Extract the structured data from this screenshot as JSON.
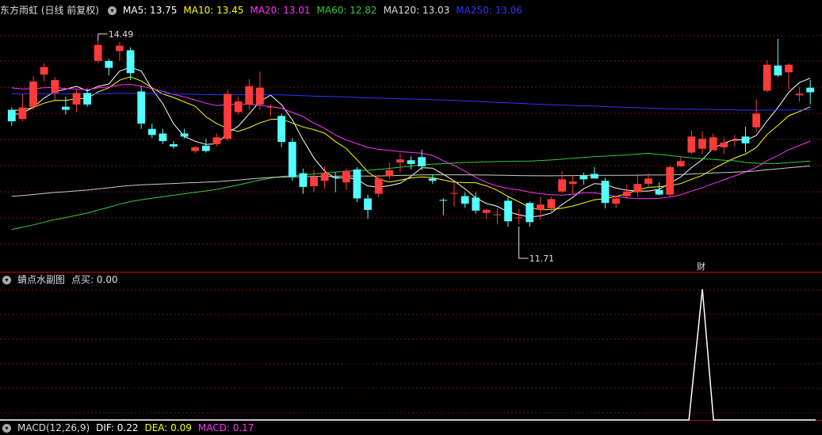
{
  "colors": {
    "up": "#ff3b3b",
    "down": "#54ffff",
    "ma5": "#ffffff",
    "ma10": "#ffff00",
    "ma20": "#ff33ff",
    "ma60": "#33cc33",
    "ma120": "#cccccc",
    "ma250": "#3333ff",
    "grid": "#7a1010",
    "divider": "#b01010",
    "indicator": "#ffffff"
  },
  "main_header": {
    "title": "东方雨虹 (日线 前复权)",
    "ma5": "MA5: 13.75",
    "ma10": "MA10: 13.45",
    "ma20": "MA20: 13.01",
    "ma60": "MA60: 12.82",
    "ma120": "MA120: 13.03",
    "ma250": "MA250: 13.06"
  },
  "price_labels": {
    "high": "14.49",
    "low": "11.71",
    "cai": "财"
  },
  "sub_header": {
    "title": "蜻点水副图",
    "value": "点买: 0.00"
  },
  "bottom_header": {
    "title": "MACD(12,26,9)",
    "dif": "DIF: 0.22",
    "dea": "DEA: 0.09",
    "macd": "MACD: 0.17"
  },
  "chart_data": {
    "type": "candlestick",
    "y_range": [
      11.5,
      14.8
    ],
    "candles": [
      [
        13.59,
        13.44,
        13.38,
        13.62
      ],
      [
        13.47,
        13.62,
        13.44,
        13.8
      ],
      [
        13.63,
        13.96,
        13.59,
        14.03
      ],
      [
        14.05,
        14.15,
        13.96,
        14.2
      ],
      [
        13.81,
        13.98,
        13.72,
        14.02
      ],
      [
        13.63,
        13.59,
        13.53,
        13.76
      ],
      [
        13.66,
        13.81,
        13.56,
        13.85
      ],
      [
        13.81,
        13.66,
        13.63,
        13.87
      ],
      [
        14.23,
        14.44,
        14.2,
        14.49
      ],
      [
        14.23,
        14.14,
        14.04,
        14.26
      ],
      [
        14.36,
        14.43,
        14.23,
        14.48
      ],
      [
        14.37,
        14.07,
        13.98,
        14.41
      ],
      [
        13.83,
        13.41,
        13.34,
        13.9
      ],
      [
        13.34,
        13.26,
        13.22,
        13.41
      ],
      [
        13.28,
        13.18,
        13.14,
        13.34
      ],
      [
        13.14,
        13.11,
        13.08,
        13.18
      ],
      [
        13.28,
        13.24,
        13.21,
        13.34
      ],
      [
        13.05,
        13.1,
        13.02,
        13.12
      ],
      [
        13.12,
        13.05,
        13.03,
        13.21
      ],
      [
        13.14,
        13.23,
        13.11,
        13.28
      ],
      [
        13.21,
        13.8,
        13.18,
        13.85
      ],
      [
        13.56,
        13.7,
        13.53,
        13.76
      ],
      [
        13.66,
        13.9,
        13.59,
        13.99
      ],
      [
        13.66,
        13.88,
        13.59,
        14.09
      ],
      [
        13.62,
        13.63,
        13.51,
        13.66
      ],
      [
        13.51,
        13.17,
        13.1,
        13.54
      ],
      [
        13.17,
        12.71,
        12.66,
        13.22
      ],
      [
        12.76,
        12.58,
        12.49,
        12.82
      ],
      [
        12.59,
        12.71,
        12.51,
        12.8
      ],
      [
        12.66,
        12.76,
        12.56,
        12.85
      ],
      [
        12.71,
        12.7,
        12.51,
        12.77
      ],
      [
        12.64,
        12.79,
        12.54,
        12.82
      ],
      [
        12.81,
        12.43,
        12.38,
        12.84
      ],
      [
        12.43,
        12.28,
        12.16,
        12.48
      ],
      [
        12.49,
        12.69,
        12.45,
        12.74
      ],
      [
        12.72,
        12.8,
        12.68,
        12.9
      ],
      [
        12.9,
        12.94,
        12.77,
        13.02
      ],
      [
        12.93,
        12.88,
        12.81,
        12.98
      ],
      [
        12.97,
        12.85,
        12.8,
        13.07
      ],
      [
        12.69,
        12.66,
        12.62,
        12.74
      ],
      [
        12.41,
        12.4,
        12.21,
        12.43
      ],
      [
        12.5,
        12.5,
        12.32,
        12.63
      ],
      [
        12.46,
        12.36,
        12.31,
        12.51
      ],
      [
        12.44,
        12.27,
        12.23,
        12.51
      ],
      [
        12.24,
        12.28,
        12.16,
        12.29
      ],
      [
        12.21,
        12.22,
        12.09,
        12.3
      ],
      [
        12.4,
        12.13,
        12.06,
        12.46
      ],
      [
        12.17,
        12.18,
        12.09,
        12.29
      ],
      [
        12.37,
        12.12,
        12.06,
        12.39
      ],
      [
        12.28,
        12.35,
        12.15,
        12.45
      ],
      [
        12.3,
        12.42,
        12.23,
        12.45
      ],
      [
        12.52,
        12.68,
        12.5,
        12.79
      ],
      [
        12.62,
        12.65,
        12.47,
        12.73
      ],
      [
        12.73,
        12.68,
        12.61,
        12.77
      ],
      [
        12.75,
        12.69,
        12.7,
        12.84
      ],
      [
        12.66,
        12.37,
        12.3,
        12.7
      ],
      [
        12.36,
        12.43,
        12.3,
        12.45
      ],
      [
        12.46,
        12.52,
        12.43,
        12.61
      ],
      [
        12.51,
        12.62,
        12.45,
        12.75
      ],
      [
        12.62,
        12.69,
        12.59,
        12.76
      ],
      [
        12.54,
        12.48,
        12.47,
        12.64
      ],
      [
        12.48,
        12.84,
        12.45,
        12.86
      ],
      [
        12.85,
        12.92,
        12.84,
        12.98
      ],
      [
        13.03,
        13.24,
        13.01,
        13.32
      ],
      [
        13.08,
        13.21,
        13.01,
        13.31
      ],
      [
        13.06,
        13.23,
        13.06,
        13.28
      ],
      [
        13.1,
        13.16,
        13.01,
        13.23
      ],
      [
        13.18,
        13.19,
        13.11,
        13.26
      ],
      [
        13.24,
        13.15,
        13.03,
        13.37
      ],
      [
        13.36,
        13.54,
        13.3,
        13.73
      ],
      [
        13.84,
        14.18,
        13.82,
        14.24
      ],
      [
        14.17,
        14.04,
        14.02,
        14.52
      ],
      [
        14.08,
        14.18,
        13.86,
        14.2
      ],
      [
        13.78,
        13.8,
        13.7,
        13.89
      ],
      [
        13.88,
        13.82,
        13.66,
        13.98
      ]
    ]
  },
  "sub_chart_data": {
    "type": "line",
    "name": "点买",
    "spike_index": 64,
    "values_note": "0 except spike"
  }
}
